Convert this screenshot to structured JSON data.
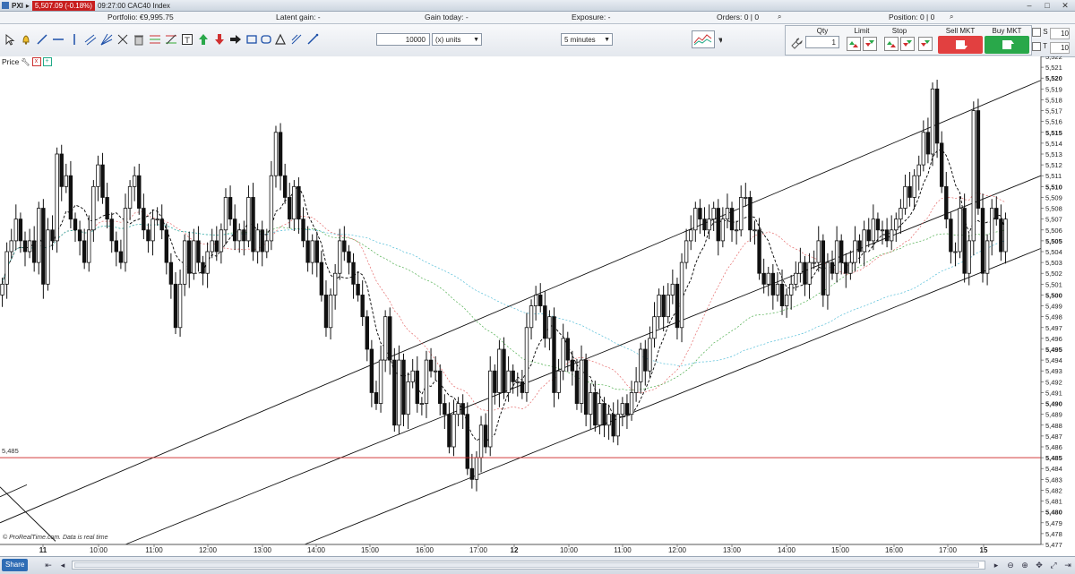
{
  "titlebar": {
    "symbol": "PXI",
    "price_badge": "5,507.09 (-0.18%)",
    "time_instrument": "09:27:00 CAC40 Index"
  },
  "portfolio_bar": {
    "portfolio": "Portfolio: €9,995.75",
    "latent_gain": "Latent gain: -",
    "gain_today": "Gain today: -",
    "exposure": "Exposure: -",
    "orders": "Orders: 0 | 0",
    "position": "Position: 0 | 0"
  },
  "toolbar": {
    "quantity_value": "10000",
    "units_select": "(x) units",
    "timeframe_select": "5 minutes"
  },
  "order_panel": {
    "qty_label": "Qty",
    "qty_value": "1",
    "limit_label": "Limit",
    "stop_label": "Stop",
    "sell_label": "Sell MKT",
    "buy_label": "Buy MKT",
    "s_label": "S",
    "s_value": "10",
    "t_label": "T",
    "t_value": "10"
  },
  "chart_header": {
    "label": "Price"
  },
  "chart_data": {
    "type": "candlestick",
    "instrument": "CAC40 Index",
    "timeframe": "5 minutes",
    "current_price": 5507.09,
    "change_pct": -0.18,
    "horizontal_line": 5485,
    "horizontal_line_label": "5,485",
    "ylim": [
      5477,
      5522
    ],
    "y_ticks": [
      5477,
      5478,
      5479,
      5480,
      5481,
      5482,
      5483,
      5484,
      5485,
      5486,
      5487,
      5488,
      5489,
      5490,
      5491,
      5492,
      5493,
      5494,
      5495,
      5496,
      5497,
      5498,
      5499,
      5500,
      5501,
      5502,
      5503,
      5504,
      5505,
      5506,
      5507,
      5508,
      5509,
      5510,
      5511,
      5512,
      5513,
      5514,
      5515,
      5516,
      5517,
      5518,
      5519,
      5520,
      5521,
      5522
    ],
    "x_ticks": [
      "11",
      "10:00",
      "11:00",
      "12:00",
      "13:00",
      "14:00",
      "15:00",
      "16:00",
      "17:00",
      "12",
      "10:00",
      "11:00",
      "12:00",
      "13:00",
      "14:00",
      "15:00",
      "16:00",
      "17:00",
      "15"
    ],
    "closes": [
      5501,
      5504,
      5505,
      5507,
      5505,
      5504,
      5505,
      5503,
      5508,
      5501,
      5506,
      5505,
      5513,
      5510,
      5511,
      5507,
      5506,
      5505,
      5503,
      5506,
      5510,
      5512,
      5509,
      5507,
      5505,
      5504,
      5503,
      5508,
      5510,
      5511,
      5508,
      5506,
      5505,
      5507,
      5507,
      5506,
      5503,
      5501,
      5497,
      5501,
      5505,
      5502,
      5505,
      5503,
      5502,
      5504,
      5505,
      5504,
      5506,
      5509,
      5507,
      5505,
      5506,
      5505,
      5509,
      5504,
      5506,
      5504,
      5505,
      5511,
      5515,
      5511,
      5509,
      5507,
      5510,
      5507,
      5505,
      5503,
      5505,
      5503,
      5500,
      5497,
      5500,
      5502,
      5505,
      5504,
      5503,
      5501,
      5500,
      5498,
      5495,
      5491,
      5490,
      5494,
      5498,
      5494,
      5488,
      5494,
      5489,
      5492,
      5493,
      5490,
      5490,
      5494,
      5493,
      5493,
      5490,
      5489,
      5486,
      5489,
      5490,
      5489,
      5484,
      5483,
      5485,
      5488,
      5486,
      5493,
      5491,
      5495,
      5491,
      5493,
      5492,
      5492,
      5491,
      5497,
      5499,
      5500,
      5499,
      5496,
      5498,
      5491,
      5493,
      5496,
      5494,
      5493,
      5490,
      5494,
      5489,
      5491,
      5488,
      5490,
      5488,
      5489,
      5487,
      5489,
      5490,
      5489,
      5491,
      5492,
      5495,
      5493,
      5496,
      5498,
      5500,
      5498,
      5500,
      5501,
      5497,
      5503,
      5505,
      5506,
      5508,
      5507,
      5506,
      5507,
      5508,
      5505,
      5507,
      5508,
      5506,
      5506,
      5509,
      5509,
      5506,
      5506,
      5502,
      5501,
      5502,
      5500,
      5501,
      5499,
      5500,
      5501,
      5502,
      5503,
      5501,
      5503,
      5503,
      5505,
      5500,
      5503,
      5502,
      5505,
      5503,
      5502,
      5503,
      5505,
      5504,
      5506,
      5505,
      5507,
      5506,
      5506,
      5505,
      5506,
      5507,
      5508,
      5510,
      5509,
      5511,
      5512,
      5515,
      5513,
      5519,
      5514,
      5510,
      5507,
      5504,
      5504,
      5508,
      5502,
      5505,
      5517,
      5508,
      5502,
      5505,
      5508,
      5507,
      5504,
      5507
    ],
    "series": [
      {
        "name": "",
        "color": "#000000",
        "style": "dashed"
      },
      {
        "name": "",
        "color": "#e05050",
        "style": "dotted"
      },
      {
        "name": "",
        "color": "#30a030",
        "style": "dotted"
      },
      {
        "name": "",
        "color": "#30b0d0",
        "style": "dotted"
      }
    ],
    "trend_channel_lines": [
      {
        "from": [
          "11 00:00",
          5479
        ],
        "to": [
          "15 end",
          5519
        ]
      },
      {
        "from": [
          "11 12:30",
          5477
        ],
        "to": [
          "15 end",
          5511
        ]
      },
      {
        "from": [
          "11 14:00",
          5477
        ],
        "to": [
          "15 end",
          5504
        ]
      }
    ],
    "footer_text": "© ProRealTime.com. Data is real time",
    "grid": false
  },
  "statusbar": {
    "share_label": "Share"
  },
  "colors": {
    "up_candle": "#ffffff",
    "down_candle": "#111111",
    "sell": "#e24040",
    "buy": "#29a84a",
    "badge": "#c81e1e",
    "hline": "#cc2222"
  }
}
